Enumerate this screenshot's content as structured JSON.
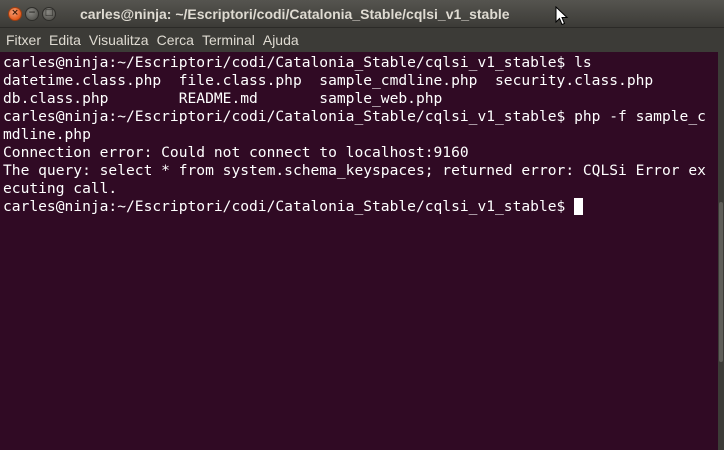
{
  "window": {
    "title": "carles@ninja: ~/Escriptori/codi/Catalonia_Stable/cqlsi_v1_stable",
    "buttons": {
      "close": "×",
      "minimize": "−",
      "maximize": "□"
    }
  },
  "menu": [
    {
      "label": "Fitxer"
    },
    {
      "label": "Edita"
    },
    {
      "label": "Visualitza"
    },
    {
      "label": "Cerca"
    },
    {
      "label": "Terminal"
    },
    {
      "label": "Ajuda"
    }
  ],
  "terminal": {
    "background": "#300a24",
    "foreground": "#ffffff",
    "lines": [
      "carles@ninja:~/Escriptori/codi/Catalonia_Stable/cqlsi_v1_stable$ ls",
      "datetime.class.php  file.class.php  sample_cmdline.php  security.class.php",
      "db.class.php        README.md       sample_web.php",
      "carles@ninja:~/Escriptori/codi/Catalonia_Stable/cqlsi_v1_stable$ php -f sample_c",
      "mdline.php",
      "Connection error: Could not connect to localhost:9160",
      "The query: select * from system.schema_keyspaces; returned error: CQLSi Error ex",
      "ecuting call."
    ],
    "prompt": "carles@ninja:~/Escriptori/codi/Catalonia_Stable/cqlsi_v1_stable$ "
  }
}
